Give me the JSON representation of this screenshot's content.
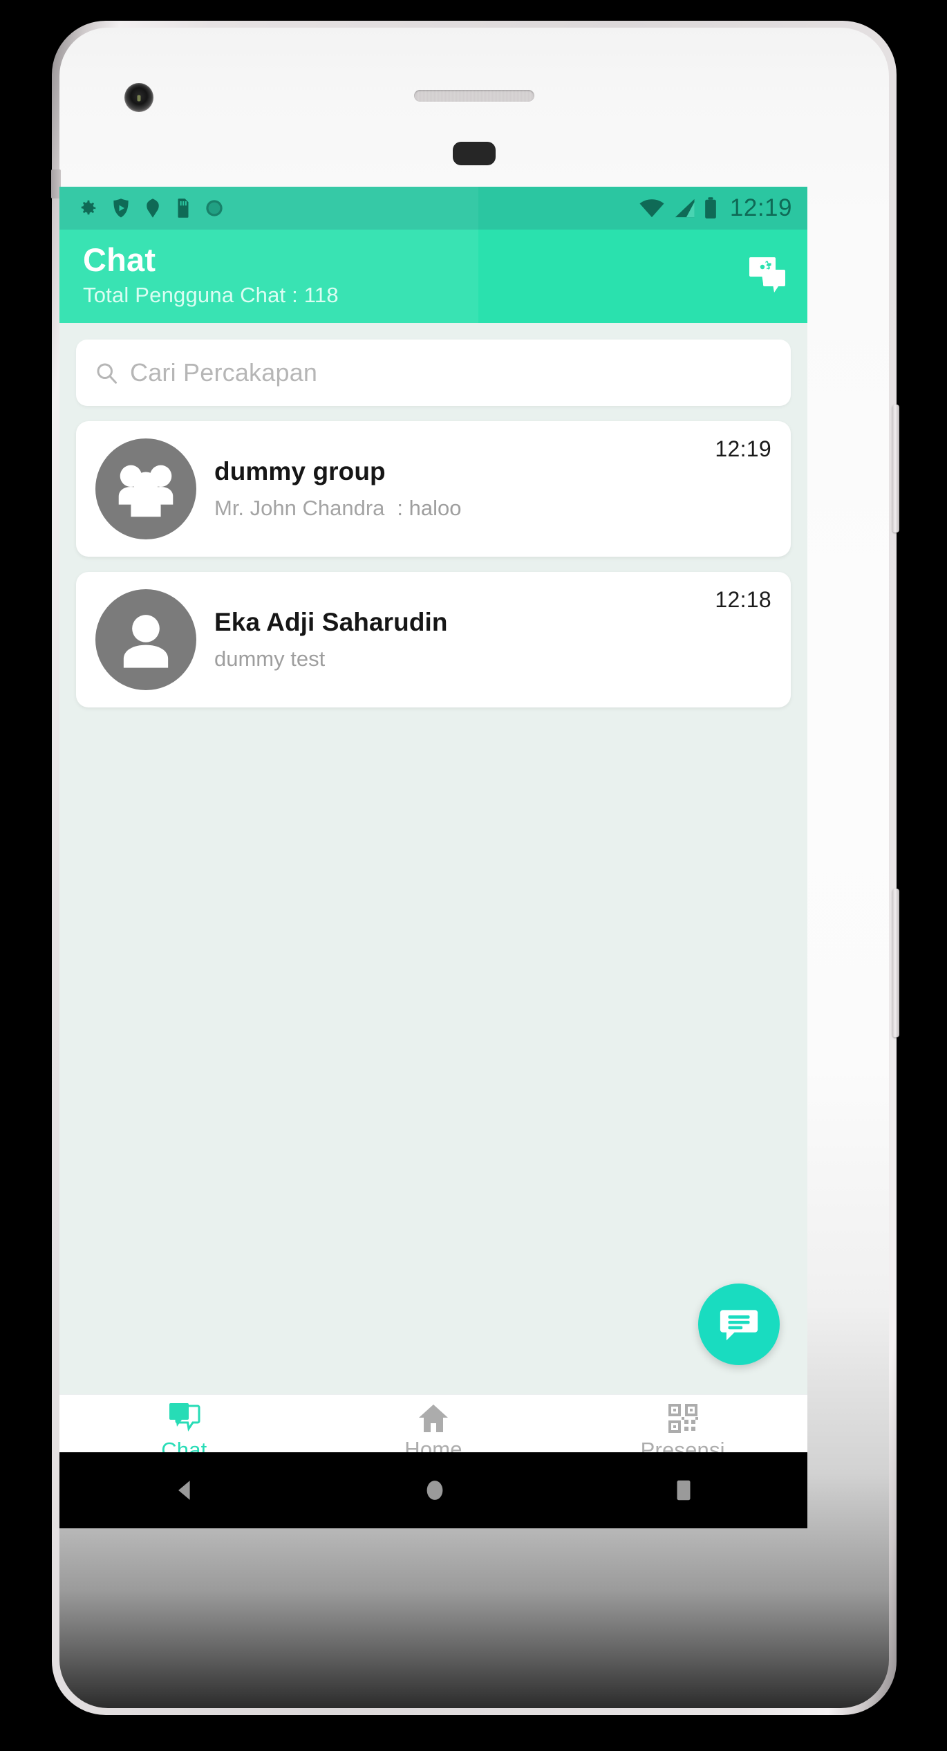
{
  "status_bar": {
    "time": "12:19",
    "left_icons": [
      "gear-icon",
      "shield-play-icon",
      "android-head-icon",
      "sd-card-icon",
      "circle-dotted-icon"
    ],
    "right_icons": [
      "wifi-icon",
      "cellular-signal-icon",
      "battery-icon"
    ],
    "background_color": "#2bc6a1",
    "icon_color": "#0f6a56"
  },
  "app_bar": {
    "title": "Chat",
    "subtitle": "Total Pengguna Chat : 118",
    "action_icon": "chat-settings-icon",
    "background_color": "#2ae1ae",
    "title_color": "#ffffff"
  },
  "search": {
    "placeholder": "Cari Percakapan",
    "icon": "search-icon",
    "value": ""
  },
  "chats": [
    {
      "name": "dummy group",
      "sender": "Mr. John Chandra",
      "message": ": haloo",
      "time": "12:19",
      "avatar": "group-avatar-icon",
      "is_group": true
    },
    {
      "name": "Eka Adji Saharudin",
      "sender": "",
      "message": "dummy test",
      "time": "12:18",
      "avatar": "person-avatar-icon",
      "is_group": false
    }
  ],
  "fab": {
    "icon": "new-chat-icon",
    "color": "#19dcc0"
  },
  "bottom_nav": {
    "active_color": "#27dcb6",
    "inactive_color": "#acacac",
    "items": [
      {
        "label": "Chat",
        "icon": "chat-bubbles-icon",
        "active": true
      },
      {
        "label": "Home",
        "icon": "home-icon",
        "active": false
      },
      {
        "label": "Presensi",
        "icon": "qr-code-icon",
        "active": false
      }
    ]
  },
  "android_nav": {
    "back": "back-triangle-icon",
    "home": "home-circle-icon",
    "recents": "recents-square-icon"
  }
}
